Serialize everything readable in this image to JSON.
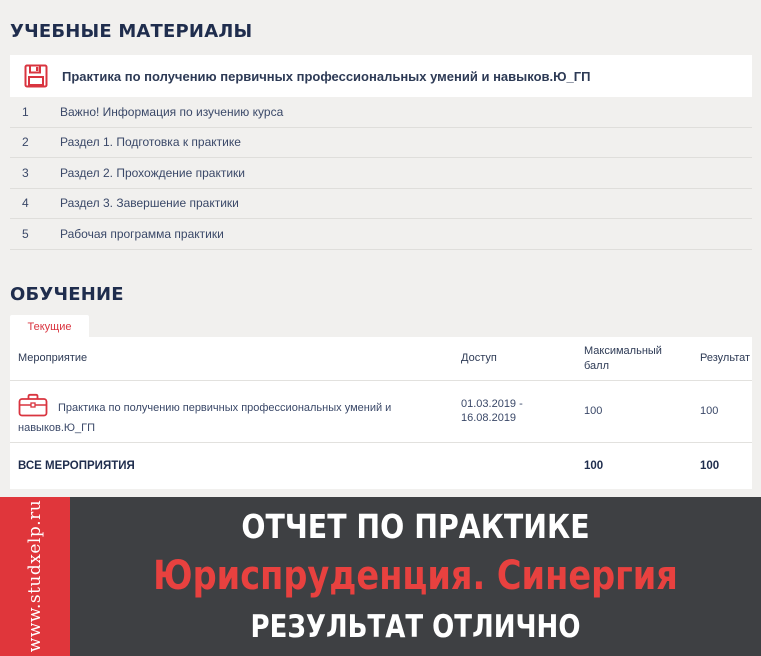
{
  "materials_section": {
    "title": "УЧЕБНЫЕ МАТЕРИАЛЫ",
    "course_title": "Практика по получению первичных профессиональных умений и навыков.Ю_ГП",
    "items": [
      {
        "num": "1",
        "label": "Важно! Информация по изучению курса"
      },
      {
        "num": "2",
        "label": "Раздел 1. Подготовка к практике"
      },
      {
        "num": "3",
        "label": "Раздел 2. Прохождение практики"
      },
      {
        "num": "4",
        "label": "Раздел 3. Завершение практики"
      },
      {
        "num": "5",
        "label": "Рабочая программа практики"
      }
    ]
  },
  "learning_section": {
    "title": "ОБУЧЕНИЕ",
    "tab_label": "Текущие",
    "columns": {
      "event": "Мероприятие",
      "access": "Доступ",
      "max_score": "Максимальный балл",
      "result": "Результат"
    },
    "rows": [
      {
        "title": "Практика по получению первичных профессиональных умений и навыков.Ю_ГП",
        "access": "01.03.2019 - 16.08.2019",
        "max_score": "100",
        "result": "100"
      }
    ],
    "total": {
      "label": "ВСЕ МЕРОПРИЯТИЯ",
      "max_score": "100",
      "result": "100"
    }
  },
  "banner": {
    "side_text": "www.studxelp.ru",
    "line1": "ОТЧЕТ ПО ПРАКТИКЕ",
    "line2": "Юриспруденция. Синергия",
    "line3": "РЕЗУЛЬТАТ ОТЛИЧНО"
  },
  "colors": {
    "accent_red": "#d9343f",
    "navy": "#1f2d4d",
    "banner_bg": "#3e4043"
  },
  "icons": {
    "course": "floppy-disk-icon",
    "event": "briefcase-icon"
  }
}
